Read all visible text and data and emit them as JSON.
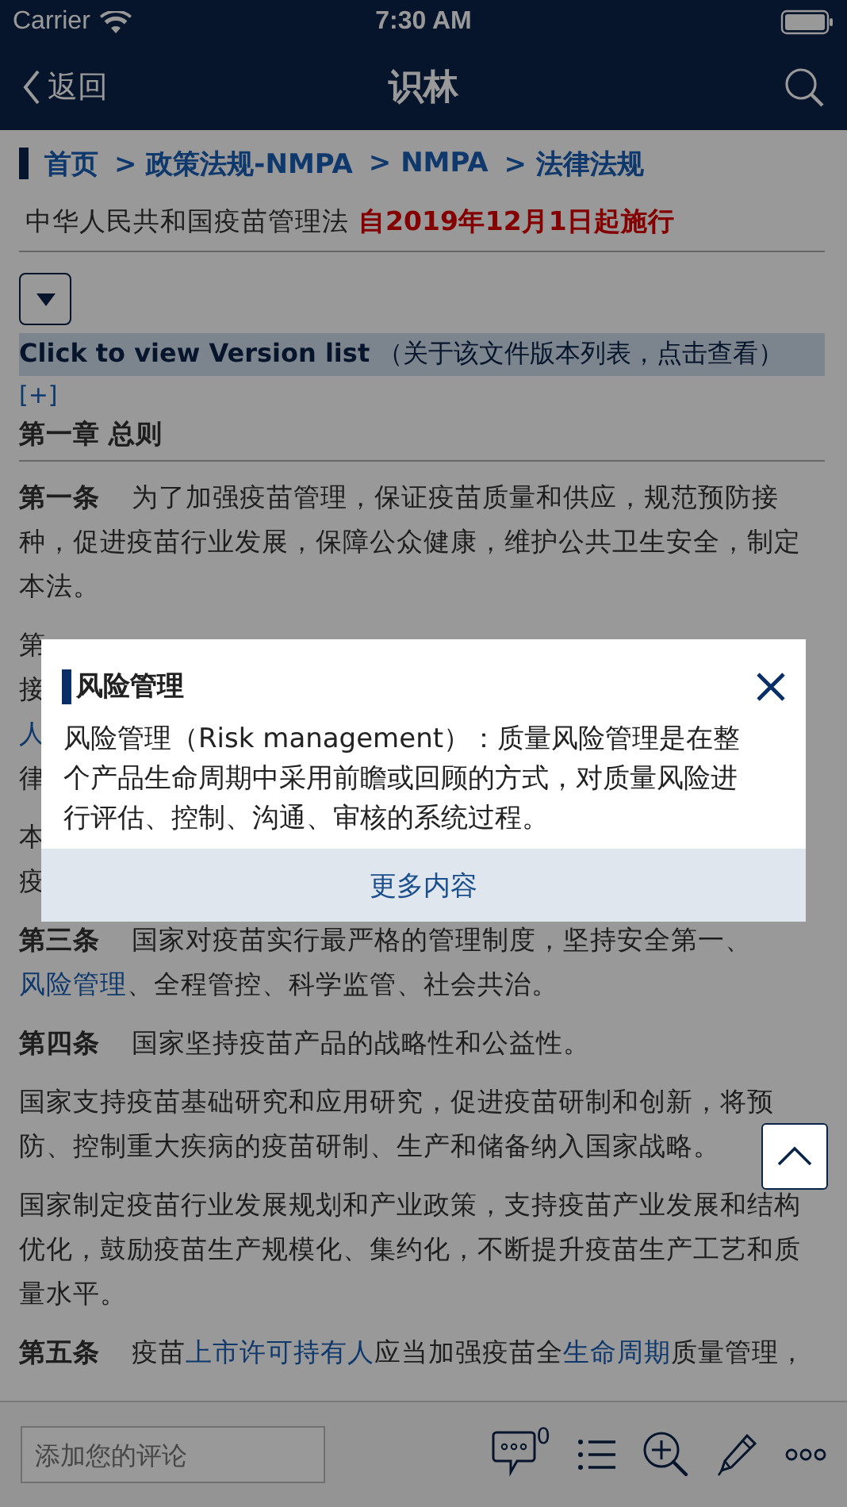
{
  "status_bar": {
    "carrier": "Carrier",
    "time": "7:30 AM"
  },
  "nav": {
    "back": "返回",
    "title": "识林"
  },
  "breadcrumb": [
    {
      "label": "首页"
    },
    {
      "label": "> 政策法规-NMPA"
    },
    {
      "label": "> NMPA"
    },
    {
      "label": "> 法律法规"
    }
  ],
  "document": {
    "title": "中华人民共和国疫苗管理法",
    "effective": "自2019年12月1日起施行"
  },
  "version_link": "**Click to view Version list** （关于该文件版本列表，点击查看）",
  "expand": "[+]",
  "chapter": "第一章 总则",
  "paragraphs": [
    {
      "kind": "article",
      "label": "第一条",
      "segments": [
        {
          "text": "为了加强疫苗管理，保证疫苗质量和供应，规范预防接种，促进疫苗行业发展，保障公众健康，维护公共卫生安全，制定本法。",
          "link": false
        }
      ]
    },
    {
      "kind": "covered",
      "lines": [
        {
          "text": "第",
          "link": false
        },
        {
          "text": "接",
          "link": false
        },
        {
          "text": "人",
          "link": true
        },
        {
          "text": "律",
          "link": false
        }
      ]
    },
    {
      "kind": "covered",
      "lines": [
        {
          "text": "本",
          "link": false
        },
        {
          "text": "疫",
          "link": false
        }
      ]
    },
    {
      "kind": "article",
      "label": "第三条",
      "segments": [
        {
          "text": "国家对疫苗实行最严格的管理制度，坚持安全第一、",
          "link": false
        },
        {
          "text": "风险管理",
          "link": true
        },
        {
          "text": "、全程管控、科学监管、社会共治。",
          "link": false
        }
      ]
    },
    {
      "kind": "article",
      "label": "第四条",
      "segments": [
        {
          "text": "国家坚持疫苗产品的战略性和公益性。",
          "link": false
        }
      ]
    },
    {
      "kind": "text",
      "segments": [
        {
          "text": "国家支持疫苗基础研究和应用研究，促进疫苗研制和创新，将预防、控制重大疾病的疫苗研制、生产和储备纳入国家战略。",
          "link": false
        }
      ]
    },
    {
      "kind": "text",
      "segments": [
        {
          "text": "国家制定疫苗行业发展规划和产业政策，支持疫苗产业发展和结构优化，鼓励疫苗生产规模化、集约化，不断提升疫苗生产工艺和质量水平。",
          "link": false
        }
      ]
    },
    {
      "kind": "article",
      "label": "第五条",
      "segments": [
        {
          "text": "疫苗",
          "link": false
        },
        {
          "text": "上市许可持有人",
          "link": true
        },
        {
          "text": "应当加强疫苗全",
          "link": false
        },
        {
          "text": "生命周期",
          "link": true
        },
        {
          "text": "质量管理，",
          "link": false
        }
      ]
    }
  ],
  "popup": {
    "title": "风险管理",
    "body": "风险管理（Risk management）：质量风险管理是在整个产品生命周期中采用前瞻或回顾的方式，对质量风险进行评估、控制、沟通、审核的系统过程。",
    "more": "更多内容"
  },
  "toolbar": {
    "comment_placeholder": "添加您的评论",
    "comment_count": "0"
  }
}
